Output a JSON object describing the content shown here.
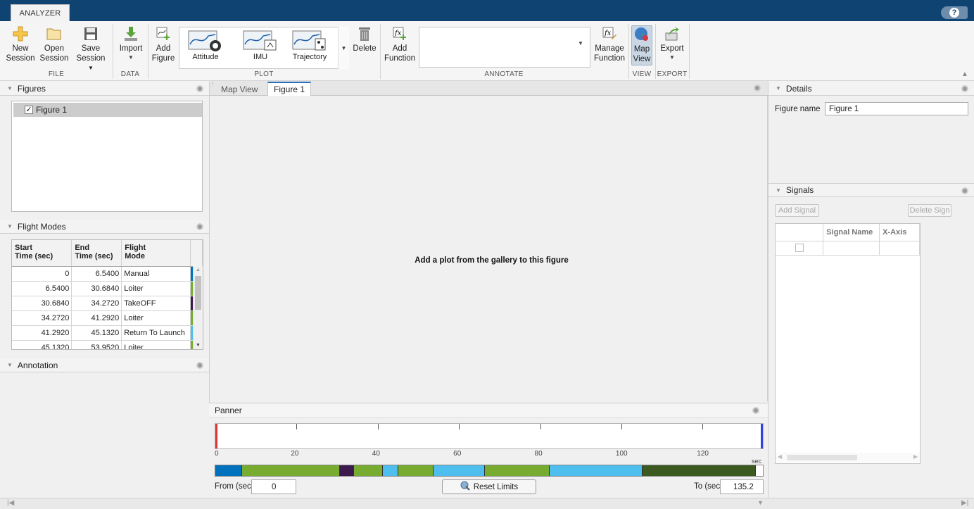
{
  "header": {
    "tab": "ANALYZER",
    "help": "?"
  },
  "toolstrip": {
    "file": {
      "label": "FILE",
      "new": [
        "New",
        "Session"
      ],
      "open": [
        "Open",
        "Session"
      ],
      "save": [
        "Save",
        "Session"
      ]
    },
    "data": {
      "label": "DATA",
      "import": "Import"
    },
    "plot": {
      "label": "PLOT",
      "add_figure": [
        "Add",
        "Figure"
      ],
      "gallery": [
        "Attitude",
        "IMU",
        "Trajectory"
      ],
      "delete": "Delete"
    },
    "annotate": {
      "label": "ANNOTATE",
      "add_function": [
        "Add",
        "Function"
      ],
      "manage_function": [
        "Manage",
        "Function"
      ]
    },
    "view": {
      "label": "VIEW",
      "map_view": [
        "Map",
        "View"
      ]
    },
    "export": {
      "label": "EXPORT",
      "export": "Export"
    }
  },
  "figures_panel": {
    "title": "Figures",
    "items": [
      {
        "label": "Figure 1",
        "checked": true
      }
    ]
  },
  "flight_modes_panel": {
    "title": "Flight Modes",
    "columns": [
      "Start Time (sec)",
      "End Time (sec)",
      "Flight Mode"
    ],
    "col_labels": [
      [
        "Start",
        "Time (sec)"
      ],
      [
        "End",
        "Time (sec)"
      ],
      [
        "Flight",
        "Mode"
      ]
    ],
    "rows": [
      {
        "start": "0",
        "end": "6.5400",
        "mode": "Manual",
        "color": "#0072bd"
      },
      {
        "start": "6.5400",
        "end": "30.6840",
        "mode": "Loiter",
        "color": "#77ac30"
      },
      {
        "start": "30.6840",
        "end": "34.2720",
        "mode": "TakeOFF",
        "color": "#3d1a4e"
      },
      {
        "start": "34.2720",
        "end": "41.2920",
        "mode": "Loiter",
        "color": "#77ac30"
      },
      {
        "start": "41.2920",
        "end": "45.1320",
        "mode": "Return To Launch",
        "color": "#4dbeee"
      },
      {
        "start": "45.1320",
        "end": "53.9520",
        "mode": "Loiter",
        "color": "#77ac30"
      }
    ]
  },
  "annotation_panel": {
    "title": "Annotation"
  },
  "center": {
    "tabs": [
      "Map View",
      "Figure 1"
    ],
    "active_tab": "Figure 1",
    "empty_message": "Add a plot from the gallery to this figure"
  },
  "panner": {
    "title": "Panner",
    "ticks": [
      "0",
      "20",
      "40",
      "60",
      "80",
      "100",
      "120"
    ],
    "unit": "sec",
    "xlim": [
      0,
      135.2
    ],
    "from_label": "From (sec)",
    "from_value": "0",
    "to_label": "To (sec)",
    "to_value": "135.2",
    "reset_label": "Reset Limits",
    "timeline": [
      {
        "start": 0,
        "end": 6.54,
        "color": "#0072bd"
      },
      {
        "start": 6.54,
        "end": 30.684,
        "color": "#77ac30"
      },
      {
        "start": 30.684,
        "end": 34.272,
        "color": "#3d1a4e"
      },
      {
        "start": 34.272,
        "end": 41.292,
        "color": "#77ac30"
      },
      {
        "start": 41.292,
        "end": 45.132,
        "color": "#4dbeee"
      },
      {
        "start": 45.132,
        "end": 53.952,
        "color": "#77ac30"
      },
      {
        "start": 53.952,
        "end": 66.5,
        "color": "#4dbeee"
      },
      {
        "start": 66.5,
        "end": 82.5,
        "color": "#77ac30"
      },
      {
        "start": 82.5,
        "end": 105.5,
        "color": "#4dbeee"
      },
      {
        "start": 105.5,
        "end": 133.5,
        "color": "#3c5a1f"
      }
    ]
  },
  "details_panel": {
    "title": "Details",
    "figure_name_label": "Figure name",
    "figure_name_value": "Figure 1"
  },
  "signals_panel": {
    "title": "Signals",
    "add_label": "Add Signal",
    "delete_label": "Delete Sign",
    "columns": [
      "",
      "Signal Name",
      "X-Axis"
    ]
  }
}
